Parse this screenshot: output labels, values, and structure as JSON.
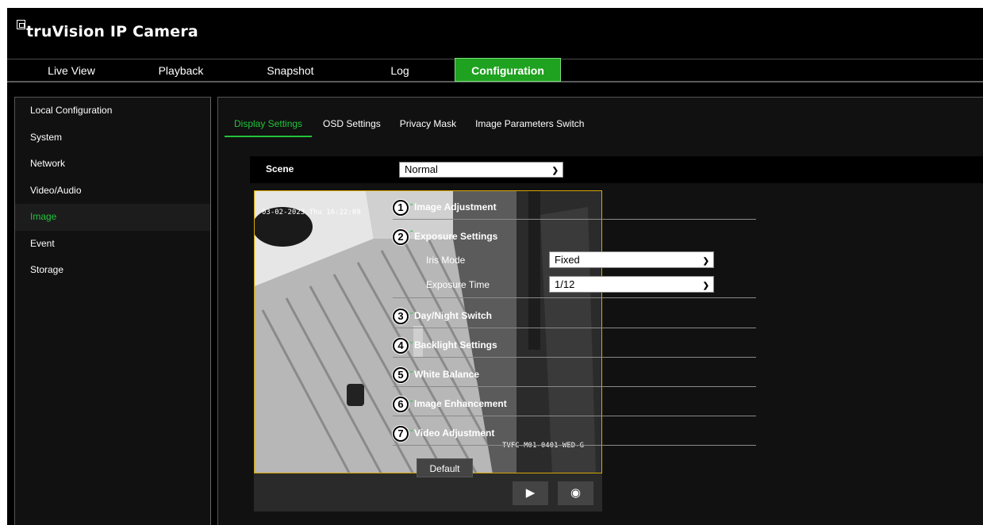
{
  "brand": {
    "title": "truVision IP Camera",
    "logo_icon": "truvision-logo-icon"
  },
  "nav": {
    "tabs": [
      "Live View",
      "Playback",
      "Snapshot",
      "Log",
      "Configuration"
    ],
    "active": "Configuration"
  },
  "sidebar": {
    "items": [
      "Local Configuration",
      "System",
      "Network",
      "Video/Audio",
      "Image",
      "Event",
      "Storage"
    ],
    "active": "Image"
  },
  "subtabs": {
    "items": [
      "Display Settings",
      "OSD Settings",
      "Privacy Mask",
      "Image Parameters Switch"
    ],
    "active": "Display Settings"
  },
  "scene": {
    "label": "Scene",
    "value": "Normal"
  },
  "preview": {
    "timestamp": "03-02-2023 Thu 16:22:09",
    "camera_name": "TVFC-M01-0401-WED-G",
    "record_icon": "video-record-icon",
    "snapshot_icon": "camera-snapshot-icon"
  },
  "sections": [
    {
      "num": "1",
      "title": "Image Adjustment",
      "state": "collapsed"
    },
    {
      "num": "2",
      "title": "Exposure Settings",
      "state": "expanded"
    },
    {
      "num": "3",
      "title": "Day/Night Switch",
      "state": "collapsed"
    },
    {
      "num": "4",
      "title": "Backlight Settings",
      "state": "collapsed"
    },
    {
      "num": "5",
      "title": "White Balance",
      "state": "collapsed"
    },
    {
      "num": "6",
      "title": "Image Enhancement",
      "state": "collapsed"
    },
    {
      "num": "7",
      "title": "Video Adjustment",
      "state": "collapsed"
    }
  ],
  "exposure": {
    "iris_mode_label": "Iris Mode",
    "iris_mode_value": "Fixed",
    "exposure_time_label": "Exposure Time",
    "exposure_time_value": "1/12"
  },
  "default_button": "Default",
  "icons": {
    "collapsed": "chevron-down-icon",
    "expanded": "chevron-up-icon",
    "dropdown": "dropdown-arrow-icon"
  },
  "colors": {
    "accent": "#22c33a",
    "active_tab_bg": "#1fa21f",
    "preview_border": "#d4a800"
  }
}
